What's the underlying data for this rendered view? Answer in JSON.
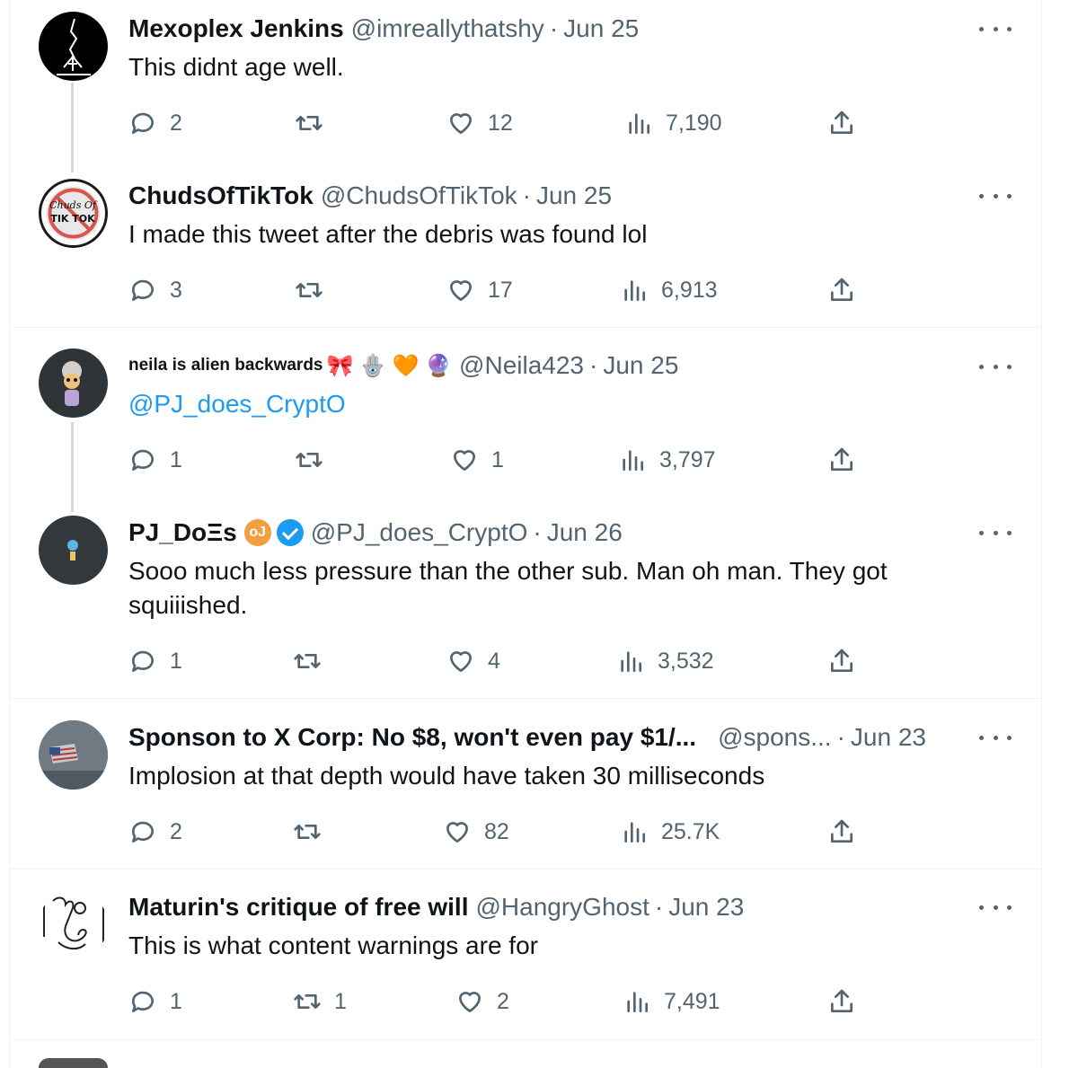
{
  "tweets": [
    {
      "name": "Mexoplex Jenkins",
      "handle": "@imreallythatshy",
      "date": "Jun 25",
      "text": "This didnt age well.",
      "replies": "2",
      "retweets": "",
      "likes": "12",
      "views": "7,190"
    },
    {
      "name": "ChudsOfTikTok",
      "handle": "@ChudsOfTikTok",
      "date": "Jun 25",
      "text": "I made this tweet after the debris was found lol",
      "replies": "3",
      "retweets": "",
      "likes": "17",
      "views": "6,913",
      "avatar_text": "Chuds Of TIK TOK"
    },
    {
      "name": "neila is alien backwards",
      "handle": "@Neila423",
      "date": "Jun 25",
      "emojis": "🎀 🪬 🧡 🔮",
      "text": "@PJ_does_CryptO",
      "replies": "1",
      "retweets": "",
      "likes": "1",
      "views": "3,797"
    },
    {
      "name": "PJ_DoΞs",
      "handle": "@PJ_does_CryptO",
      "date": "Jun 26",
      "badge": "oJ",
      "text": "Sooo much less pressure than the other sub.  Man oh man.  They got squiiished.",
      "replies": "1",
      "retweets": "",
      "likes": "4",
      "views": "3,532"
    },
    {
      "name": "Sponson to X Corp: No $8, won't even pay $1/...",
      "handle": "@spons...",
      "date": "Jun 23",
      "text": "Implosion at that depth would have taken 30 milliseconds",
      "replies": "2",
      "retweets": "",
      "likes": "82",
      "views": "25.7K"
    },
    {
      "name": "Maturin's critique of free will",
      "handle": "@HangryGhost",
      "date": "Jun 23",
      "text": "This is what content warnings are for",
      "replies": "1",
      "retweets": "1",
      "likes": "2",
      "views": "7,491"
    }
  ],
  "dot_separator": "·",
  "colors": {
    "text": "#0f1419",
    "muted": "#536471",
    "link": "#1d9bf0",
    "border": "#eff3f4",
    "thread": "#cfd9de"
  },
  "icons": [
    "reply-icon",
    "retweet-icon",
    "like-icon",
    "views-icon",
    "share-icon",
    "more-icon",
    "verified-icon"
  ]
}
